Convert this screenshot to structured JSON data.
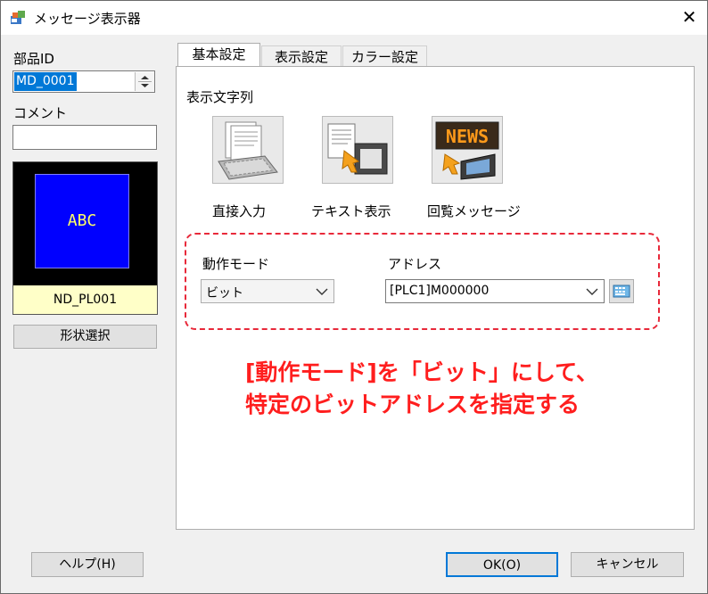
{
  "window": {
    "title": "メッセージ表示器",
    "close_glyph": "✕"
  },
  "left": {
    "part_id_label": "部品ID",
    "part_id_value": "MD_0001",
    "comment_label": "コメント",
    "comment_value": "",
    "preview_text": "ABC",
    "preview_name": "ND_PL001",
    "shape_button": "形状選択"
  },
  "tabs": [
    {
      "label": "基本設定",
      "active": true
    },
    {
      "label": "表示設定",
      "active": false
    },
    {
      "label": "カラー設定",
      "active": false
    }
  ],
  "panel": {
    "section_label": "表示文字列",
    "options": [
      {
        "label": "直接入力",
        "icon": "keyboard-document-icon"
      },
      {
        "label": "テキスト表示",
        "icon": "text-file-icon"
      },
      {
        "label": "回覧メッセージ",
        "icon": "news-board-icon"
      }
    ],
    "news_text": "NEWS",
    "operation_mode_label": "動作モード",
    "operation_mode_value": "ビット",
    "address_label": "アドレス",
    "address_value": "[PLC1]M000000"
  },
  "annotation": {
    "line1": "[動作モード]を「ビット」にして、",
    "line2": "特定のビットアドレスを指定する",
    "color": "#ff1e1e"
  },
  "footer": {
    "help_button": "ヘルプ(H)",
    "ok_button": "OK(O)",
    "cancel_button": "キャンセル"
  },
  "colors": {
    "preview_blue": "#0000ff",
    "preview_text": "#ffff66",
    "name_bg": "#ffffc8",
    "dashed": "#e8293a"
  }
}
